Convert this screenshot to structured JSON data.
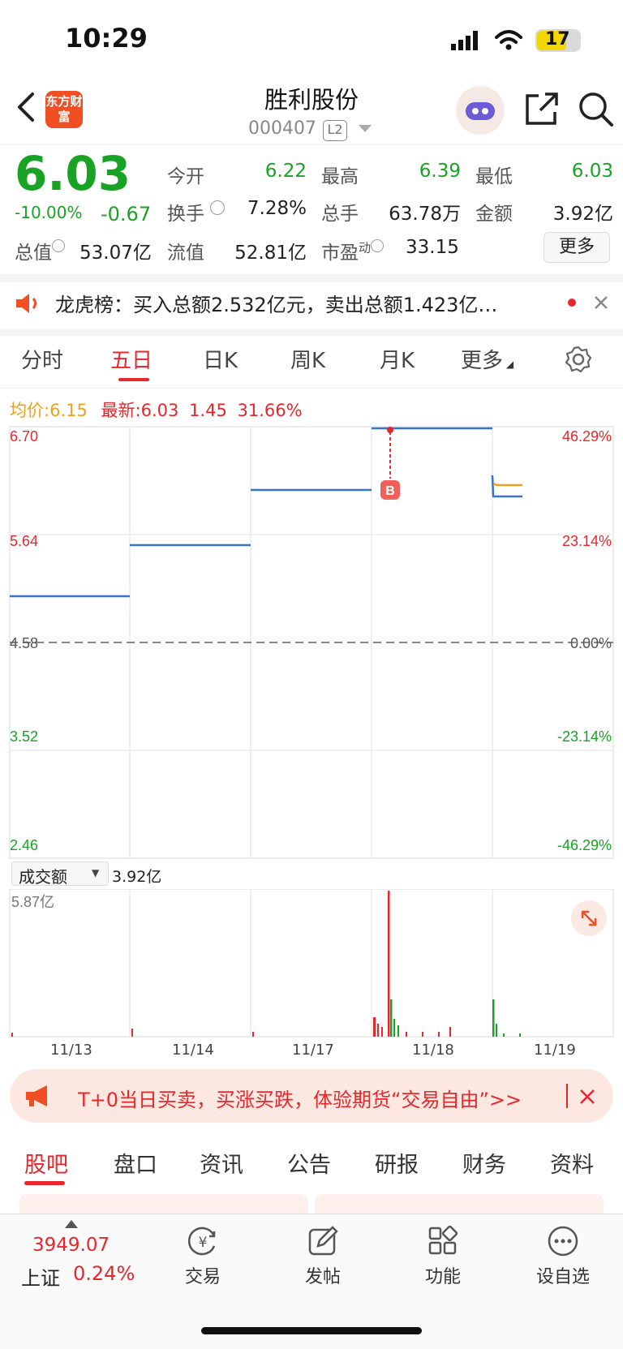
{
  "status_bar": {
    "time": "10:29",
    "battery": "17"
  },
  "header": {
    "logo_text": "东方财富",
    "title": "胜利股份",
    "code": "000407",
    "level": "L2"
  },
  "quote": {
    "price": "6.03",
    "change_pct": "-10.00%",
    "change": "-0.67",
    "fields": [
      {
        "label": "今开",
        "value": "6.22"
      },
      {
        "label": "最高",
        "value": "6.39"
      },
      {
        "label": "最低",
        "value": "6.03"
      },
      {
        "label": "换手",
        "value": "7.28%"
      },
      {
        "label": "总手",
        "value": "63.78万"
      },
      {
        "label": "金额",
        "value": "3.92亿"
      },
      {
        "label": "总值",
        "value": "53.07亿"
      },
      {
        "label": "流值",
        "value": "52.81亿"
      },
      {
        "label": "市盈",
        "superscript": "动",
        "value": "33.15"
      }
    ],
    "more_label": "更多"
  },
  "notice": {
    "text": "龙虎榜：买入总额2.532亿元，卖出总额1.423亿…"
  },
  "tabs": [
    {
      "label": "分时"
    },
    {
      "label": "五日"
    },
    {
      "label": "日K"
    },
    {
      "label": "周K"
    },
    {
      "label": "月K"
    },
    {
      "label": "更多"
    }
  ],
  "legend": {
    "avg_label": "均价:",
    "avg_value": "6.15",
    "latest_label": "最新:",
    "latest_value": "6.03",
    "change": "1.45",
    "change_pct": "31.66%"
  },
  "chart": {
    "price_labels": [
      "6.70",
      "5.64",
      "4.58",
      "3.52",
      "2.46"
    ],
    "pct_labels": [
      "46.29%",
      "23.14%",
      "0.00%",
      "-23.14%",
      "-46.29%"
    ],
    "marker": "B",
    "volume_selector": "成交额",
    "volume_total": "3.92亿",
    "volume_max": "5.87亿",
    "dates": [
      "11/13",
      "11/14",
      "11/17",
      "11/18",
      "11/19"
    ]
  },
  "colors": {
    "up": "#e8262c",
    "down": "#19a325",
    "line": "#3a72c8",
    "avg": "#f0a11a"
  },
  "promo": {
    "text": "T+0当日买卖，买涨买跌，体验期货“交易自由”>>"
  },
  "sub_tabs": [
    {
      "label": "股吧"
    },
    {
      "label": "盘口"
    },
    {
      "label": "资讯"
    },
    {
      "label": "公告"
    },
    {
      "label": "研报"
    },
    {
      "label": "财务"
    },
    {
      "label": "资料"
    }
  ],
  "bottom_nav": {
    "index_value": "3949.07",
    "index_name": "上证",
    "index_change": "0.24%",
    "items": [
      {
        "label": "交易",
        "icon": "yuan-exchange-icon"
      },
      {
        "label": "发帖",
        "icon": "edit-icon"
      },
      {
        "label": "功能",
        "icon": "grid-icon"
      },
      {
        "label": "设自选",
        "icon": "more-circle-icon"
      }
    ]
  }
}
